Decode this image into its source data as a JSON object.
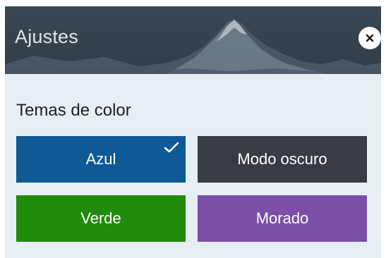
{
  "header": {
    "title": "Ajustes",
    "close_icon": "close-icon"
  },
  "section": {
    "title": "Temas de color"
  },
  "themes": [
    {
      "label": "Azul",
      "color": "#0f5a94",
      "selected": true
    },
    {
      "label": "Modo oscuro",
      "color": "#383d44",
      "selected": false
    },
    {
      "label": "Verde",
      "color": "#218b0c",
      "selected": false
    },
    {
      "label": "Morado",
      "color": "#7b4fa7",
      "selected": false
    }
  ],
  "selected_icon": "check-icon"
}
